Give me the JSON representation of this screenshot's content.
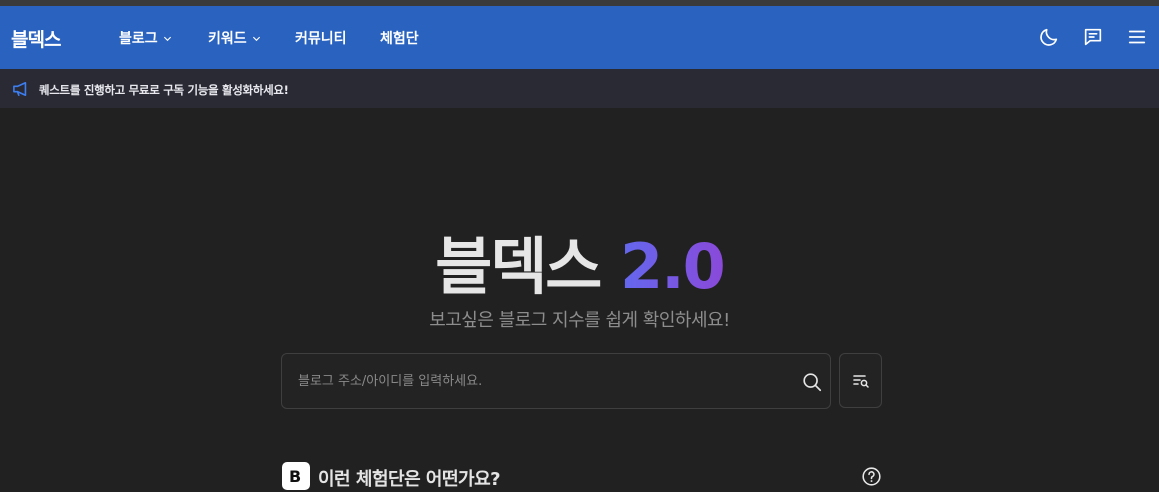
{
  "navbar": {
    "brand": "블덱스",
    "items": [
      {
        "label": "블로그",
        "has_dropdown": true
      },
      {
        "label": "키워드",
        "has_dropdown": true
      },
      {
        "label": "커뮤니티",
        "has_dropdown": false
      },
      {
        "label": "체험단",
        "has_dropdown": false
      }
    ],
    "icons": [
      "moon-icon",
      "chat-icon",
      "menu-icon"
    ],
    "background": "#2962bf"
  },
  "notice": {
    "icon": "megaphone-icon",
    "text": "퀘스트를 진행하고 무료로 구독 기능을 활성화하세요!"
  },
  "hero": {
    "title_main": "블덱스",
    "title_version": "2.0",
    "subtitle": "보고싶은 블로그 지수를 쉽게 확인하세요!",
    "accent_gradient": [
      "#6368ee",
      "#8a49d9"
    ]
  },
  "search": {
    "placeholder": "블로그 주소/아이디를 입력하세요.",
    "value": "",
    "icon": "search-icon",
    "filter_icon": "list-search-icon"
  },
  "section": {
    "logo_letter": "B",
    "title": "이런 체험단은 어떤가요?",
    "help_icon": "question-circle-icon"
  }
}
